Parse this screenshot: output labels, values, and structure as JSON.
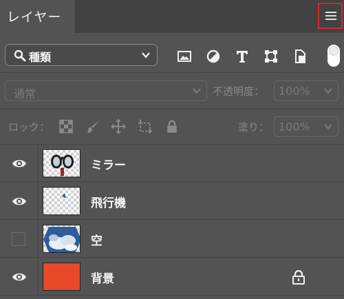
{
  "tab": {
    "title": "レイヤー"
  },
  "filter": {
    "kind_label": "種類"
  },
  "blend": {
    "mode": "通常",
    "opacity_label": "不透明度：",
    "opacity_value": "100%"
  },
  "lock": {
    "label": "ロック：",
    "fill_label": "塗り：",
    "fill_value": "100%"
  },
  "layers": [
    {
      "name": "ミラー",
      "visible": true
    },
    {
      "name": "飛行機",
      "visible": true
    },
    {
      "name": "空",
      "visible": false
    },
    {
      "name": "背景",
      "visible": true,
      "locked": true,
      "color": "#e8492b"
    }
  ],
  "colors": {
    "menu_highlight": "#d12c2c",
    "background_layer": "#e8492b"
  }
}
